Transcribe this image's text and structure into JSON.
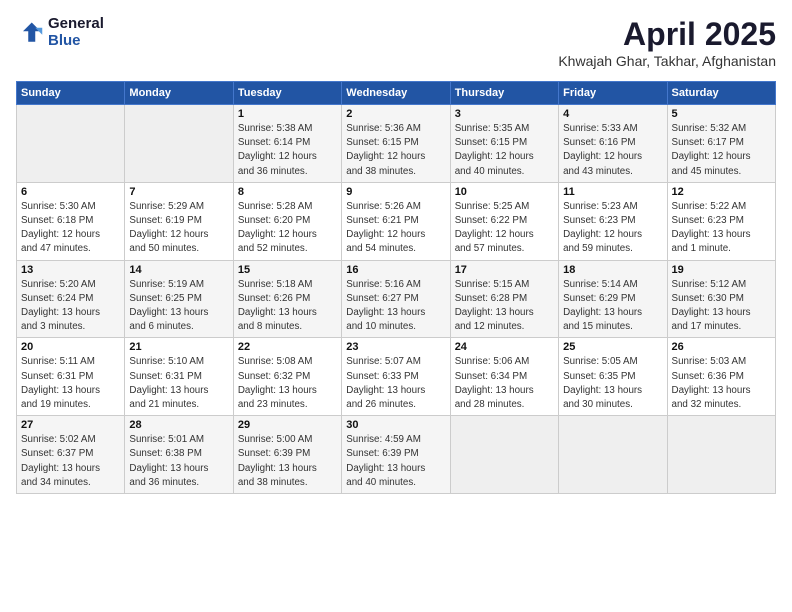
{
  "header": {
    "logo_general": "General",
    "logo_blue": "Blue",
    "month": "April 2025",
    "location": "Khwajah Ghar, Takhar, Afghanistan"
  },
  "weekdays": [
    "Sunday",
    "Monday",
    "Tuesday",
    "Wednesday",
    "Thursday",
    "Friday",
    "Saturday"
  ],
  "weeks": [
    [
      {
        "day": "",
        "detail": ""
      },
      {
        "day": "",
        "detail": ""
      },
      {
        "day": "1",
        "detail": "Sunrise: 5:38 AM\nSunset: 6:14 PM\nDaylight: 12 hours\nand 36 minutes."
      },
      {
        "day": "2",
        "detail": "Sunrise: 5:36 AM\nSunset: 6:15 PM\nDaylight: 12 hours\nand 38 minutes."
      },
      {
        "day": "3",
        "detail": "Sunrise: 5:35 AM\nSunset: 6:15 PM\nDaylight: 12 hours\nand 40 minutes."
      },
      {
        "day": "4",
        "detail": "Sunrise: 5:33 AM\nSunset: 6:16 PM\nDaylight: 12 hours\nand 43 minutes."
      },
      {
        "day": "5",
        "detail": "Sunrise: 5:32 AM\nSunset: 6:17 PM\nDaylight: 12 hours\nand 45 minutes."
      }
    ],
    [
      {
        "day": "6",
        "detail": "Sunrise: 5:30 AM\nSunset: 6:18 PM\nDaylight: 12 hours\nand 47 minutes."
      },
      {
        "day": "7",
        "detail": "Sunrise: 5:29 AM\nSunset: 6:19 PM\nDaylight: 12 hours\nand 50 minutes."
      },
      {
        "day": "8",
        "detail": "Sunrise: 5:28 AM\nSunset: 6:20 PM\nDaylight: 12 hours\nand 52 minutes."
      },
      {
        "day": "9",
        "detail": "Sunrise: 5:26 AM\nSunset: 6:21 PM\nDaylight: 12 hours\nand 54 minutes."
      },
      {
        "day": "10",
        "detail": "Sunrise: 5:25 AM\nSunset: 6:22 PM\nDaylight: 12 hours\nand 57 minutes."
      },
      {
        "day": "11",
        "detail": "Sunrise: 5:23 AM\nSunset: 6:23 PM\nDaylight: 12 hours\nand 59 minutes."
      },
      {
        "day": "12",
        "detail": "Sunrise: 5:22 AM\nSunset: 6:23 PM\nDaylight: 13 hours\nand 1 minute."
      }
    ],
    [
      {
        "day": "13",
        "detail": "Sunrise: 5:20 AM\nSunset: 6:24 PM\nDaylight: 13 hours\nand 3 minutes."
      },
      {
        "day": "14",
        "detail": "Sunrise: 5:19 AM\nSunset: 6:25 PM\nDaylight: 13 hours\nand 6 minutes."
      },
      {
        "day": "15",
        "detail": "Sunrise: 5:18 AM\nSunset: 6:26 PM\nDaylight: 13 hours\nand 8 minutes."
      },
      {
        "day": "16",
        "detail": "Sunrise: 5:16 AM\nSunset: 6:27 PM\nDaylight: 13 hours\nand 10 minutes."
      },
      {
        "day": "17",
        "detail": "Sunrise: 5:15 AM\nSunset: 6:28 PM\nDaylight: 13 hours\nand 12 minutes."
      },
      {
        "day": "18",
        "detail": "Sunrise: 5:14 AM\nSunset: 6:29 PM\nDaylight: 13 hours\nand 15 minutes."
      },
      {
        "day": "19",
        "detail": "Sunrise: 5:12 AM\nSunset: 6:30 PM\nDaylight: 13 hours\nand 17 minutes."
      }
    ],
    [
      {
        "day": "20",
        "detail": "Sunrise: 5:11 AM\nSunset: 6:31 PM\nDaylight: 13 hours\nand 19 minutes."
      },
      {
        "day": "21",
        "detail": "Sunrise: 5:10 AM\nSunset: 6:31 PM\nDaylight: 13 hours\nand 21 minutes."
      },
      {
        "day": "22",
        "detail": "Sunrise: 5:08 AM\nSunset: 6:32 PM\nDaylight: 13 hours\nand 23 minutes."
      },
      {
        "day": "23",
        "detail": "Sunrise: 5:07 AM\nSunset: 6:33 PM\nDaylight: 13 hours\nand 26 minutes."
      },
      {
        "day": "24",
        "detail": "Sunrise: 5:06 AM\nSunset: 6:34 PM\nDaylight: 13 hours\nand 28 minutes."
      },
      {
        "day": "25",
        "detail": "Sunrise: 5:05 AM\nSunset: 6:35 PM\nDaylight: 13 hours\nand 30 minutes."
      },
      {
        "day": "26",
        "detail": "Sunrise: 5:03 AM\nSunset: 6:36 PM\nDaylight: 13 hours\nand 32 minutes."
      }
    ],
    [
      {
        "day": "27",
        "detail": "Sunrise: 5:02 AM\nSunset: 6:37 PM\nDaylight: 13 hours\nand 34 minutes."
      },
      {
        "day": "28",
        "detail": "Sunrise: 5:01 AM\nSunset: 6:38 PM\nDaylight: 13 hours\nand 36 minutes."
      },
      {
        "day": "29",
        "detail": "Sunrise: 5:00 AM\nSunset: 6:39 PM\nDaylight: 13 hours\nand 38 minutes."
      },
      {
        "day": "30",
        "detail": "Sunrise: 4:59 AM\nSunset: 6:39 PM\nDaylight: 13 hours\nand 40 minutes."
      },
      {
        "day": "",
        "detail": ""
      },
      {
        "day": "",
        "detail": ""
      },
      {
        "day": "",
        "detail": ""
      }
    ]
  ]
}
